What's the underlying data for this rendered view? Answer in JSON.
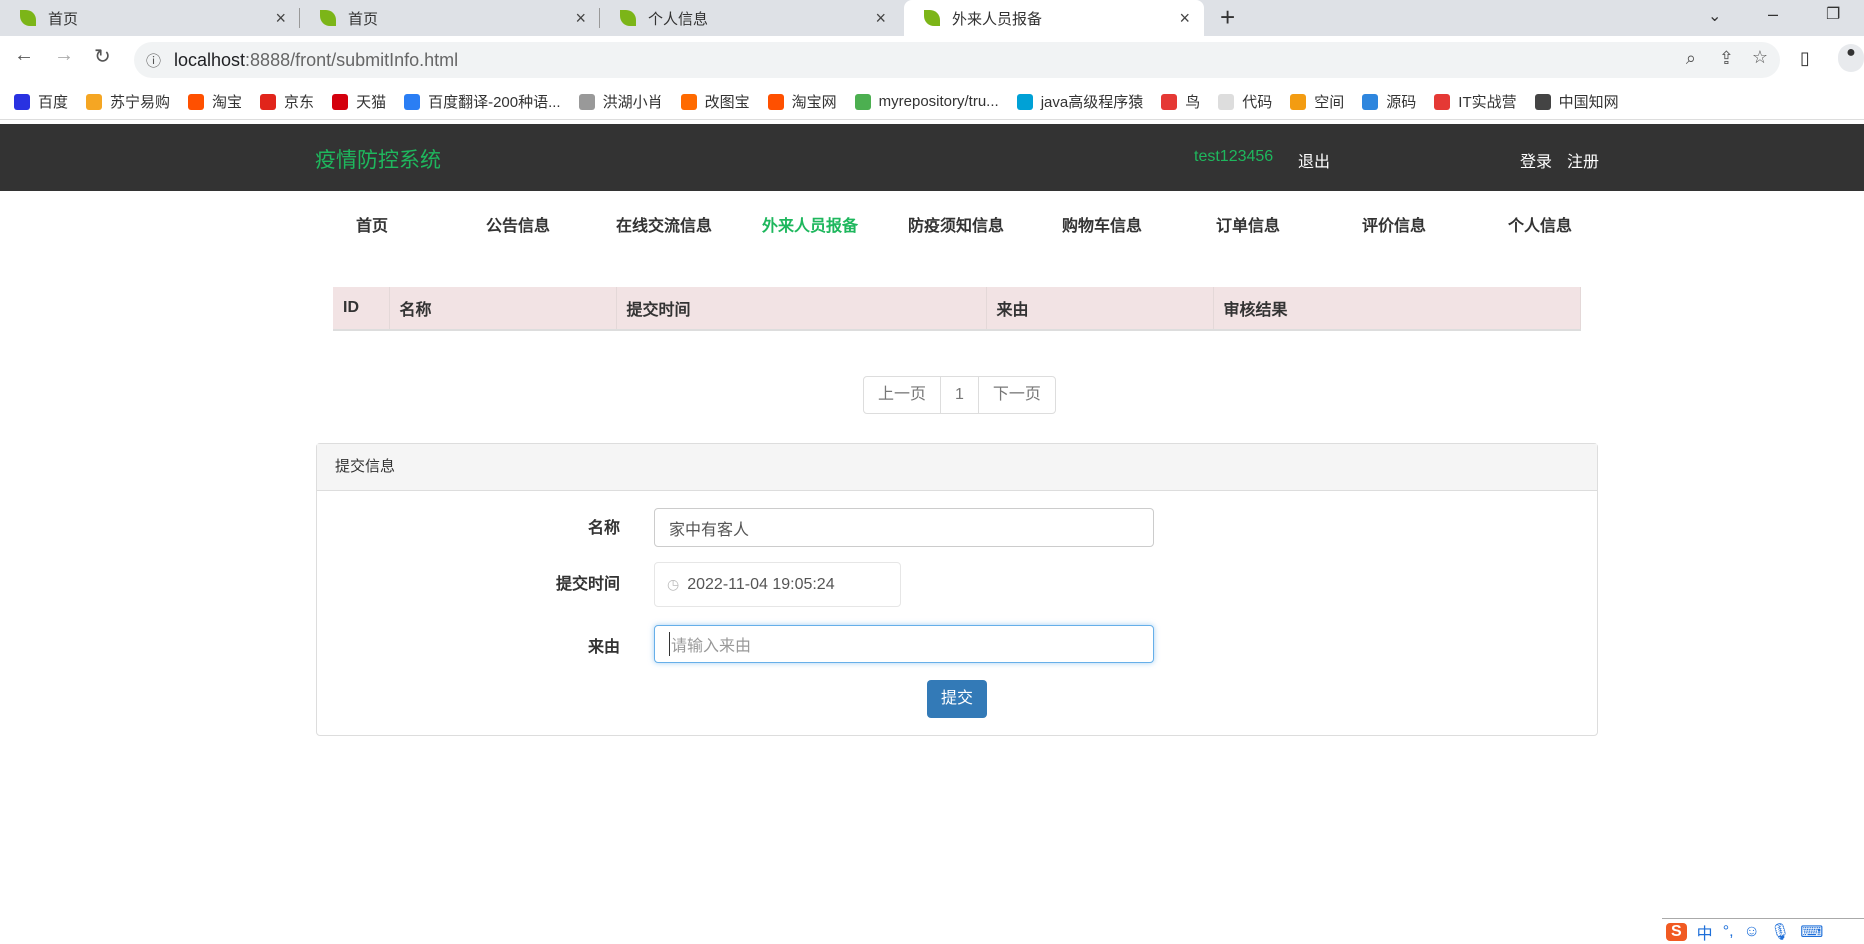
{
  "browser": {
    "tabs": [
      {
        "label": "首页"
      },
      {
        "label": "首页"
      },
      {
        "label": "个人信息"
      },
      {
        "label": "外来人员报备",
        "active": true
      }
    ],
    "url_host": "localhost",
    "url_rest": ":8888/front/submitInfo.html",
    "bookmarks": [
      {
        "label": "百度",
        "color": "#2932e1"
      },
      {
        "label": "苏宁易购",
        "color": "#f5a623"
      },
      {
        "label": "淘宝",
        "color": "#ff5000"
      },
      {
        "label": "京东",
        "color": "#e1251b"
      },
      {
        "label": "天猫",
        "color": "#d4000d"
      },
      {
        "label": "百度翻译-200种语...",
        "color": "#2a7ef4"
      },
      {
        "label": "洪湖小肖",
        "color": "#999"
      },
      {
        "label": "改图宝",
        "color": "#ff6a00"
      },
      {
        "label": "淘宝网",
        "color": "#ff5000"
      },
      {
        "label": "myrepository/tru...",
        "color": "#4caf50"
      },
      {
        "label": "java高级程序猿",
        "color": "#00a1d6"
      },
      {
        "label": "鸟",
        "color": "#e53935"
      },
      {
        "label": "代码",
        "color": "#ddd"
      },
      {
        "label": "空间",
        "color": "#f39c12"
      },
      {
        "label": "源码",
        "color": "#2e86de"
      },
      {
        "label": "IT实战营",
        "color": "#e53935"
      },
      {
        "label": "中国知网",
        "color": "#444"
      }
    ]
  },
  "header": {
    "title": "疫情防控系统",
    "username": "test123456",
    "logout": "退出",
    "login": "登录",
    "register": "注册"
  },
  "nav": [
    "首页",
    "公告信息",
    "在线交流信息",
    "外来人员报备",
    "防疫须知信息",
    "购物车信息",
    "订单信息",
    "评价信息",
    "个人信息"
  ],
  "table": {
    "columns": [
      "ID",
      "名称",
      "提交时间",
      "来由",
      "审核结果"
    ],
    "rows": []
  },
  "pager": {
    "prev": "上一页",
    "page": "1",
    "next": "下一页"
  },
  "form": {
    "title": "提交信息",
    "name_label": "名称",
    "name_value": "家中有客人",
    "time_label": "提交时间",
    "time_value": "2022-11-04 19:05:24",
    "reason_label": "来由",
    "reason_placeholder": "请输入来由",
    "submit": "提交"
  },
  "colors": {
    "accent": "#1eb75d",
    "primary": "#337ab7",
    "header_bg": "#333333"
  }
}
